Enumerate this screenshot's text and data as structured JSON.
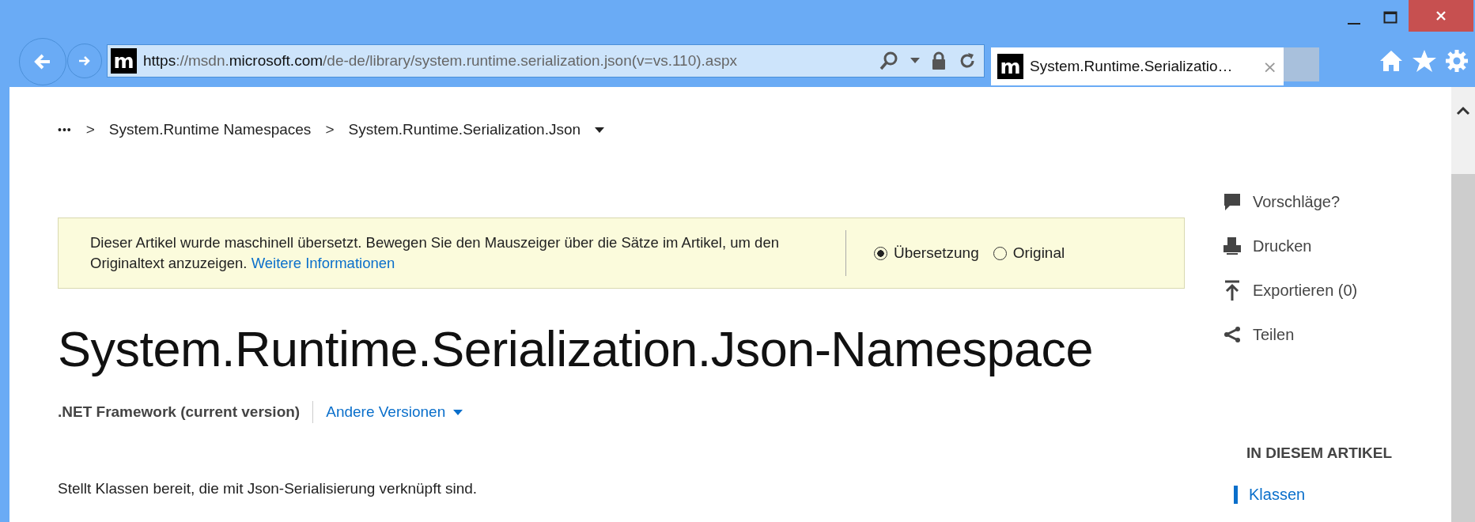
{
  "address_bar": {
    "site_icon": "m",
    "url_parts": [
      {
        "text": "https",
        "emphasis": true
      },
      {
        "text": "://msdn.",
        "emphasis": false
      },
      {
        "text": "microsoft.com",
        "emphasis": true
      },
      {
        "text": "/de-de/library/system.runtime.serialization.json(v=vs.110).aspx",
        "emphasis": false
      }
    ]
  },
  "tabs": [
    {
      "label": "System.Runtime.Serializatio…",
      "selected": true,
      "icon": "m",
      "close": "×"
    }
  ],
  "breadcrumb": {
    "ellipsis": "•••",
    "separator": ">",
    "items": [
      "System.Runtime Namespaces",
      "System.Runtime.Serialization.Json"
    ]
  },
  "banner": {
    "text": "Dieser Artikel wurde maschinell übersetzt. Bewegen Sie den Mauszeiger über die Sätze im Artikel, um den Originaltext anzuzeigen.",
    "link": "Weitere Informationen",
    "options": [
      {
        "label": "Übersetzung",
        "selected": true
      },
      {
        "label": "Original",
        "selected": false
      }
    ]
  },
  "title": "System.Runtime.Serialization.Json-Namespace",
  "version": {
    "current": ".NET Framework (current version)",
    "other": "Andere Versionen"
  },
  "description": "Stellt Klassen bereit, die mit Json-Serialisierung verknüpft sind.",
  "actions": [
    {
      "kind": "feedback",
      "label": "Vorschläge?"
    },
    {
      "kind": "print",
      "label": "Drucken"
    },
    {
      "kind": "export",
      "label": "Exportieren (0)"
    },
    {
      "kind": "share",
      "label": "Teilen"
    }
  ],
  "toc": {
    "heading": "IN DIESEM ARTIKEL",
    "items": [
      {
        "label": "Klassen",
        "selected": true
      }
    ]
  }
}
